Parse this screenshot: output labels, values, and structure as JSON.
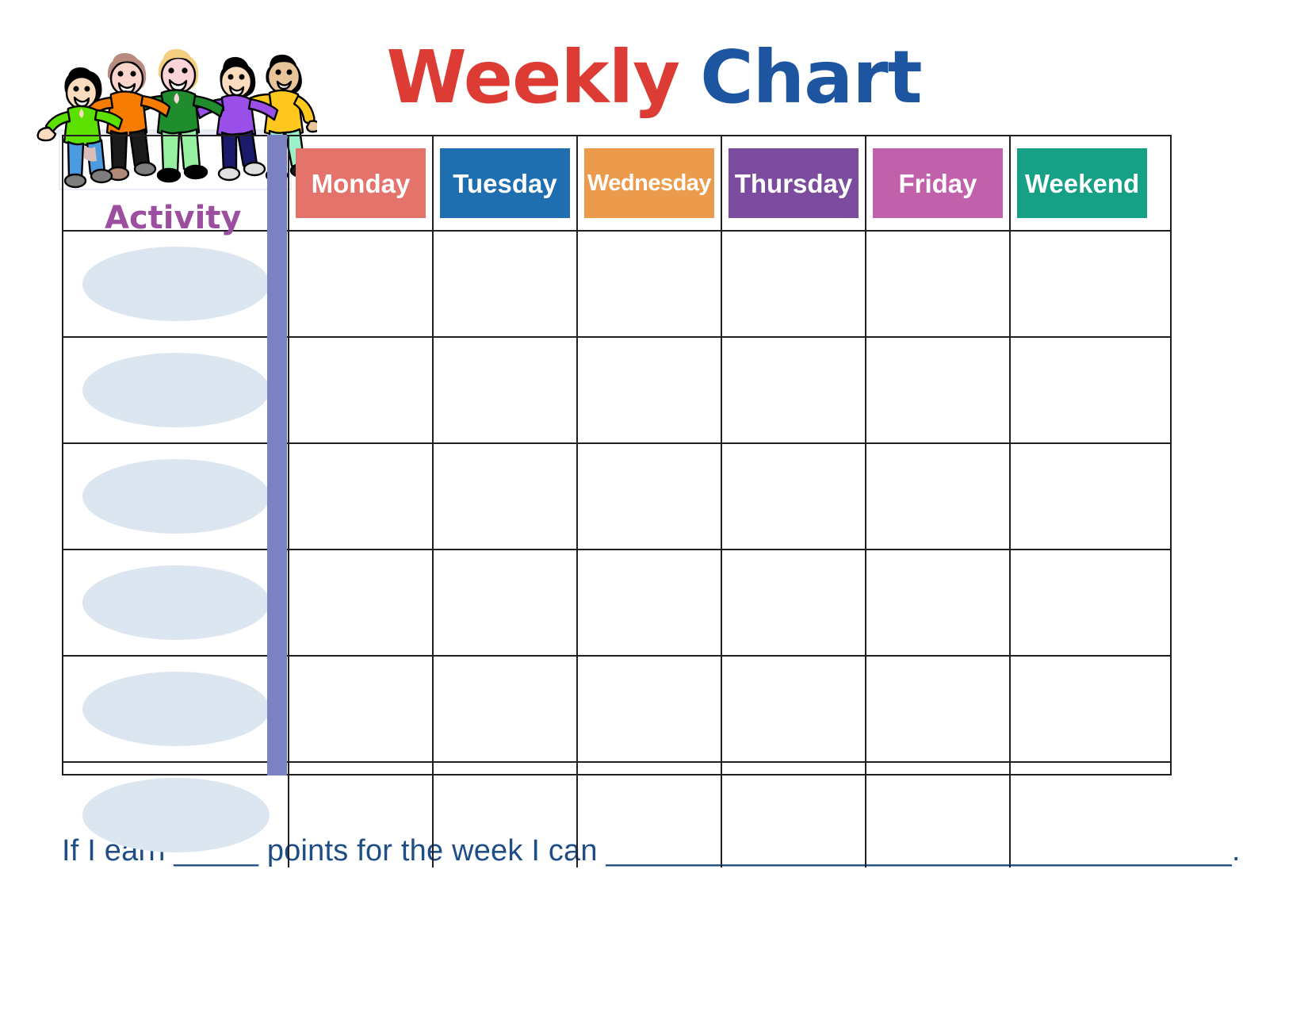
{
  "title": {
    "word1": "Weekly",
    "word2": "Chart",
    "color1": "#DC3C33",
    "color2": "#1E55A0"
  },
  "activity_column": {
    "label": "Activity",
    "label_color": "#9B4F9E",
    "oval_color": "#DCE6F1",
    "divider_bar_color": "#7B82C4",
    "rows": [
      "",
      "",
      "",
      "",
      "",
      ""
    ]
  },
  "day_columns": [
    {
      "label": "Monday",
      "color": "#E3736B"
    },
    {
      "label": "Tuesday",
      "color": "#1F6FB0"
    },
    {
      "label": "Wednesday",
      "color": "#EC9B4C"
    },
    {
      "label": "Thursday",
      "color": "#7B4B9E"
    },
    {
      "label": "Friday",
      "color": "#C261AB"
    },
    {
      "label": "Weekend",
      "color": "#16A086"
    }
  ],
  "table": {
    "row_count": 6,
    "cells": [
      [
        "",
        "",
        "",
        "",
        "",
        ""
      ],
      [
        "",
        "",
        "",
        "",
        "",
        ""
      ],
      [
        "",
        "",
        "",
        "",
        "",
        ""
      ],
      [
        "",
        "",
        "",
        "",
        "",
        ""
      ],
      [
        "",
        "",
        "",
        "",
        "",
        ""
      ],
      [
        "",
        "",
        "",
        "",
        "",
        ""
      ]
    ],
    "border_color": "#231f20"
  },
  "footer": {
    "text": "If I earn _____ points for the week I can _____________________________________.",
    "color": "#1F4E87"
  },
  "clipart": {
    "name": "five-children-hugging-clipart",
    "children": [
      {
        "shirt": "#5BE000",
        "pants": "#4A9BE0",
        "hair": "#000000",
        "skin": "#FBDCBE",
        "shoes": "#7E7E7E"
      },
      {
        "shirt": "#F57C00",
        "pants": "#1A1A1A",
        "hair": "#B88A80",
        "skin": "#FBD4CB",
        "shoes": "#B08878"
      },
      {
        "shirt": "#1F8C2E",
        "pants": "#96F0A0",
        "hair": "#F2CE7E",
        "skin": "#FBD4D8",
        "shoes": "#000000"
      },
      {
        "shirt": "#9A4FE8",
        "pants": "#1B1B6B",
        "hair": "#000000",
        "skin": "#FBDCBE",
        "shoes": "#E0E0E0"
      },
      {
        "shirt": "#FFC81F",
        "pants": "#9AF0C8",
        "hair": "#000000",
        "skin": "#E8C49A",
        "shoes": "#1A1A1A"
      }
    ]
  }
}
